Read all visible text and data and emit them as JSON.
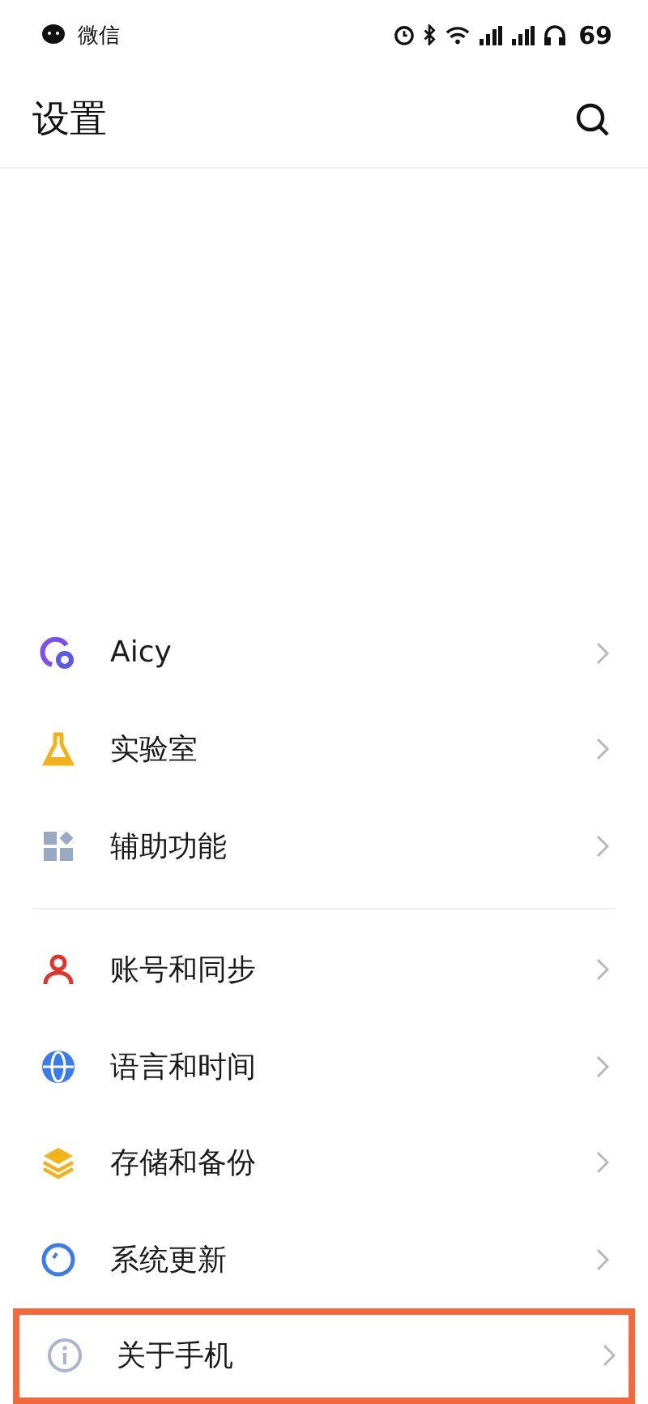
{
  "status_bar": {
    "app": "微信",
    "battery": "69"
  },
  "header": {
    "title": "设置"
  },
  "groups": [
    {
      "items": [
        {
          "label": "Aicy",
          "highlighted": false
        },
        {
          "label": "实验室",
          "highlighted": false
        },
        {
          "label": "辅助功能",
          "highlighted": false
        }
      ]
    },
    {
      "items": [
        {
          "label": "账号和同步",
          "highlighted": false
        },
        {
          "label": "语言和时间",
          "highlighted": false
        },
        {
          "label": "存储和备份",
          "highlighted": false
        },
        {
          "label": "系统更新",
          "highlighted": false
        },
        {
          "label": "关于手机",
          "highlighted": true
        }
      ]
    }
  ]
}
